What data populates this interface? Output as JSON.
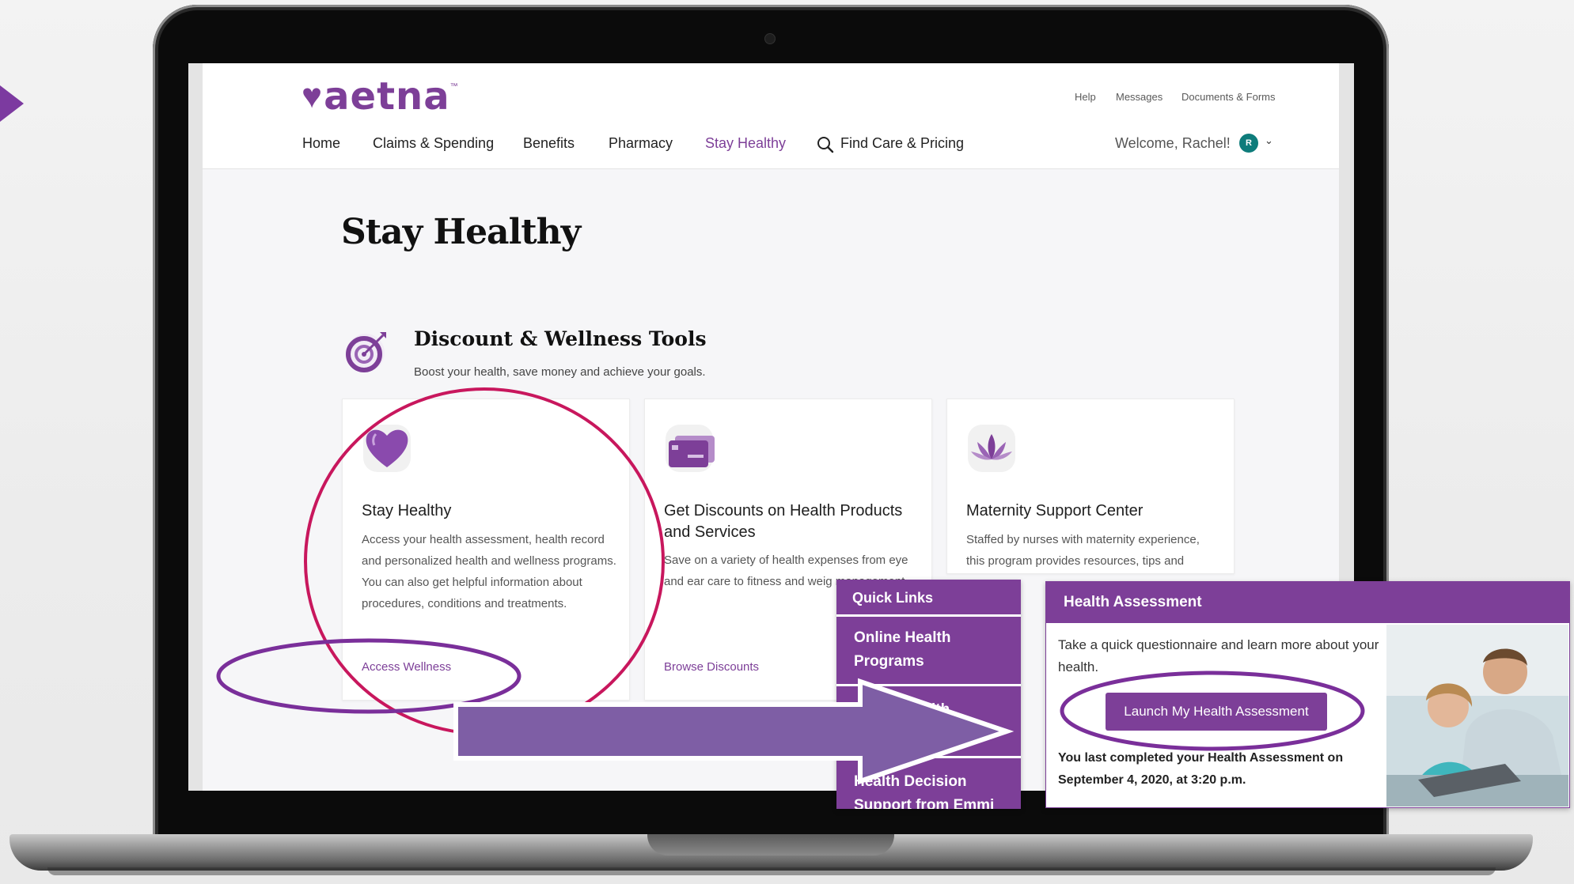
{
  "header": {
    "brand": "aetna",
    "utility_links": [
      "Help",
      "Messages",
      "Documents & Forms"
    ],
    "nav": [
      "Home",
      "Claims & Spending",
      "Benefits",
      "Pharmacy",
      "Stay Healthy",
      "Find Care & Pricing"
    ],
    "active_nav": "Stay Healthy",
    "welcome": "Welcome, Rachel!",
    "avatar_initial": "R"
  },
  "main": {
    "page_title": "Stay Healthy",
    "section": {
      "title": "Discount & Wellness Tools",
      "subtitle": "Boost your health, save money and achieve your goals."
    },
    "cards": [
      {
        "icon": "heart-icon",
        "title": "Stay Healthy",
        "body": "Access your health assessment, health record and personalized health and wellness programs. You can also get helpful information about procedures, conditions and treatments.",
        "link": "Access Wellness"
      },
      {
        "icon": "credit-card-icon",
        "title": "Get Discounts on Health Products and Services",
        "body": "Save on a variety of health expenses from eye and ear care to fitness and weig management.",
        "link": "Browse Discounts"
      },
      {
        "icon": "lotus-icon",
        "title": "Maternity Support Center",
        "body": "Staffed by nurses with maternity experience, this program provides resources, tips and",
        "link": ""
      }
    ]
  },
  "quick_links": {
    "title": "Quick Links",
    "items": [
      "Online Health Programs",
      "lth",
      "Health Decision Support from Emmi"
    ]
  },
  "health_assessment": {
    "title": "Health Assessment",
    "description": "Take a quick questionnaire and learn more about your health.",
    "button": "Launch My Health Assessment",
    "last_completed": "You last completed your Health Assessment on September 4, 2020, at 3:20 p.m."
  },
  "colors": {
    "brand_purple": "#7d3f98",
    "highlight_magenta": "#c8175d",
    "highlight_violet": "#7a2f9a",
    "arrow_fill": "#7e5ea5",
    "avatar_teal": "#0e7c7b"
  }
}
